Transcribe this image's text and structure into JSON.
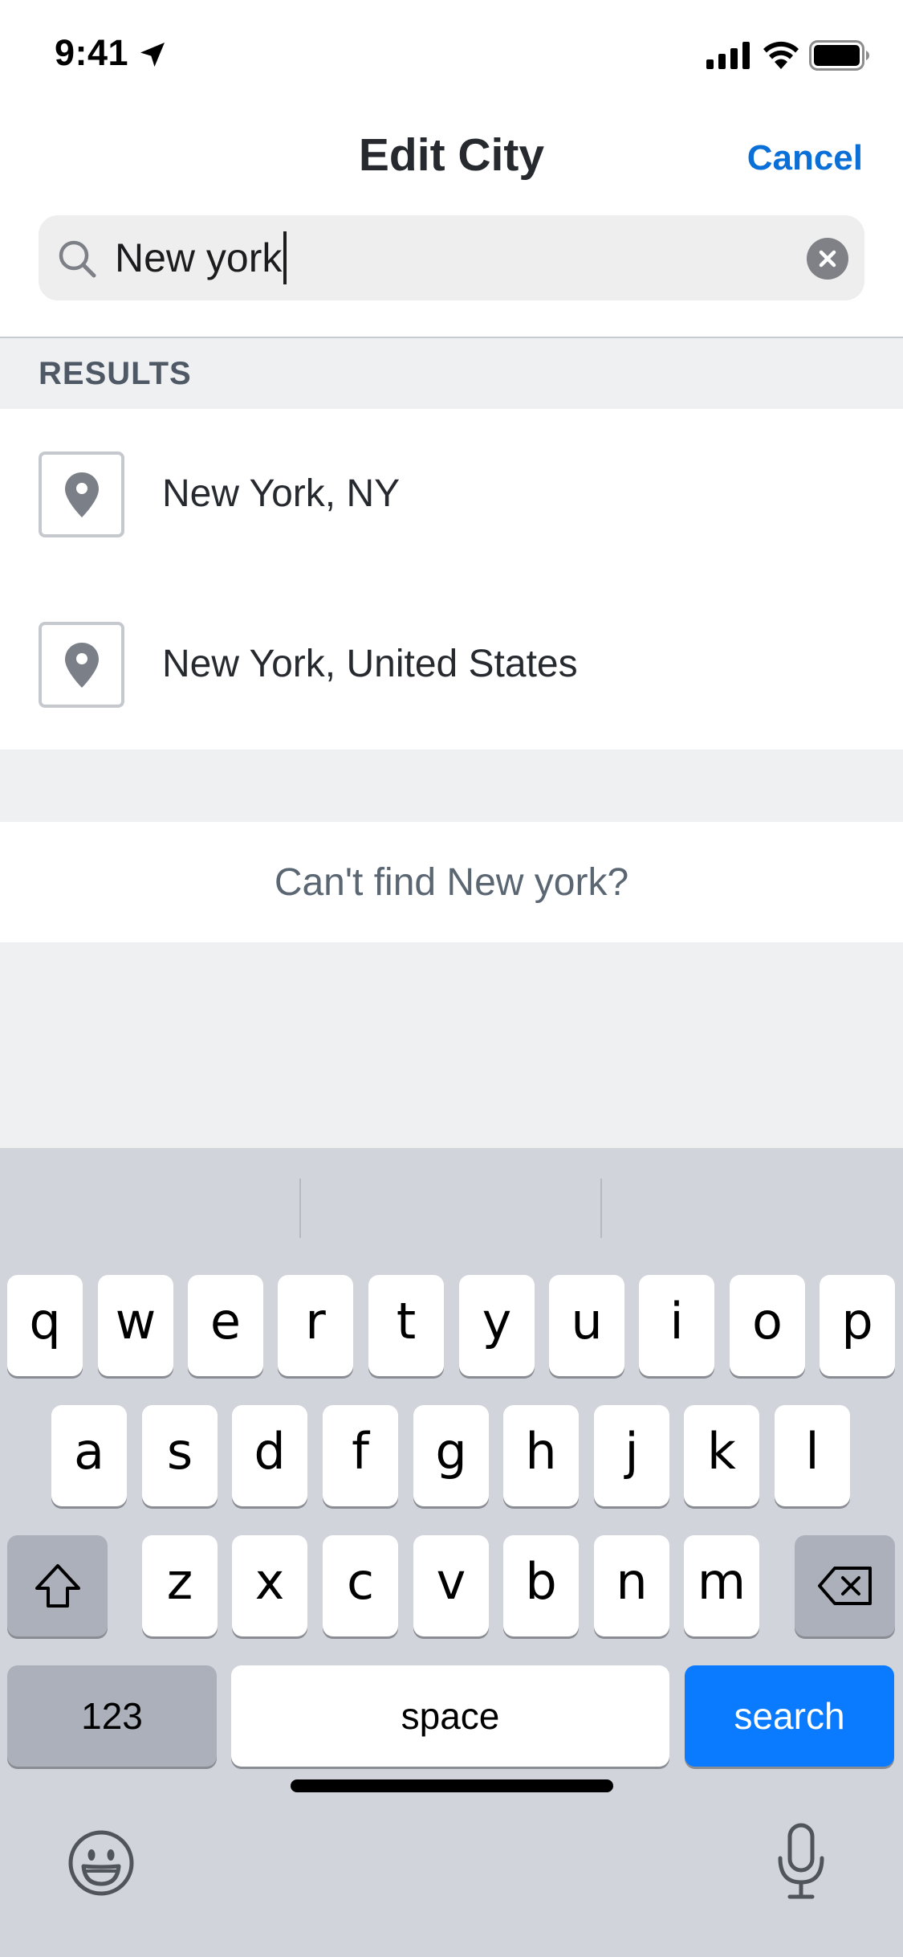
{
  "status_bar": {
    "time": "9:41"
  },
  "header": {
    "title": "Edit City",
    "cancel_label": "Cancel"
  },
  "search": {
    "value": "New york"
  },
  "results": {
    "section_label": "RESULTS",
    "items": [
      {
        "label": "New York, NY",
        "icon": "location-pin-icon"
      },
      {
        "label": "New York, United States",
        "icon": "location-pin-icon"
      }
    ],
    "cant_find": "Can't find New york?"
  },
  "keyboard": {
    "row1": [
      "q",
      "w",
      "e",
      "r",
      "t",
      "y",
      "u",
      "i",
      "o",
      "p"
    ],
    "row2": [
      "a",
      "s",
      "d",
      "f",
      "g",
      "h",
      "j",
      "k",
      "l"
    ],
    "row3": [
      "z",
      "x",
      "c",
      "v",
      "b",
      "n",
      "m"
    ],
    "numbers_label": "123",
    "space_label": "space",
    "search_label": "search"
  },
  "colors": {
    "accent": "#0a6fd6",
    "search_key": "#0a7aff",
    "keyboard_bg": "#d1d4db",
    "section_bg": "#eff0f2"
  }
}
